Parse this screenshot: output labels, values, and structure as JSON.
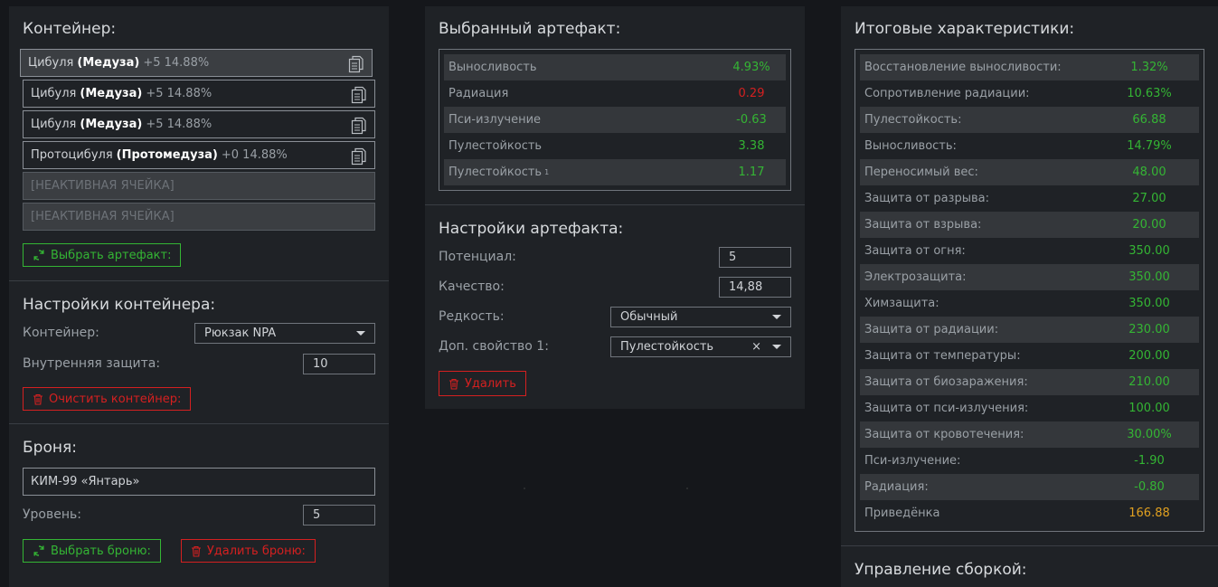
{
  "container": {
    "title": "Контейнер:",
    "slots": [
      {
        "name": "Цибуля",
        "type": "(Медуза)",
        "info": "+5 14.88%"
      },
      {
        "name": "Цибуля",
        "type": "(Медуза)",
        "info": "+5 14.88%"
      },
      {
        "name": "Цибуля",
        "type": "(Медуза)",
        "info": "+5 14.88%"
      },
      {
        "name": "Протоцибуля",
        "type": "(Протомедуза)",
        "info": "+0 14.88%"
      }
    ],
    "inactive_slot": "[НЕАКТИВНАЯ ЯЧЕЙКА]",
    "select_button": "Выбрать артефакт:"
  },
  "container_settings": {
    "title": "Настройки контейнера:",
    "container_label": "Контейнер:",
    "container_value": "Рюкзак NPA",
    "protection_label": "Внутренняя защита:",
    "protection_value": "10",
    "clear_button": "Очистить контейнер:"
  },
  "armor": {
    "title": "Броня:",
    "name": "КИМ-99 «Янтарь»",
    "level_label": "Уровень:",
    "level_value": "5",
    "select_button": "Выбрать броню:",
    "delete_button": "Удалить броню:"
  },
  "selected_artifact": {
    "title": "Выбранный артефакт:",
    "stats": [
      {
        "label": "Выносливость",
        "value": "4.93%",
        "color": "green"
      },
      {
        "label": "Радиация",
        "value": "0.29",
        "color": "red"
      },
      {
        "label": "Пси-излучение",
        "value": "-0.63",
        "color": "green"
      },
      {
        "label": "Пулестойкость",
        "value": "3.38",
        "color": "green"
      },
      {
        "label": "Пулестойкость",
        "sup": "1",
        "value": "1.17",
        "color": "green"
      }
    ]
  },
  "artifact_settings": {
    "title": "Настройки артефакта:",
    "potential_label": "Потенциал:",
    "potential_value": "5",
    "quality_label": "Качество:",
    "quality_value": "14,88",
    "rarity_label": "Редкость:",
    "rarity_value": "Обычный",
    "extra_label": "Доп. свойство 1:",
    "extra_value": "Пулестойкость",
    "delete_button": "Удалить"
  },
  "totals": {
    "title": "Итоговые характеристики:",
    "stats": [
      {
        "label": "Восстановление выносливости:",
        "value": "1.32%",
        "color": "green"
      },
      {
        "label": "Сопротивление радиации:",
        "value": "10.63%",
        "color": "green"
      },
      {
        "label": "Пулестойкость:",
        "value": "66.88",
        "color": "green"
      },
      {
        "label": "Выносливость:",
        "value": "14.79%",
        "color": "green"
      },
      {
        "label": "Переносимый вес:",
        "value": "48.00",
        "color": "green"
      },
      {
        "label": "Защита от разрыва:",
        "value": "27.00",
        "color": "green"
      },
      {
        "label": "Защита от взрыва:",
        "value": "20.00",
        "color": "green"
      },
      {
        "label": "Защита от огня:",
        "value": "350.00",
        "color": "green"
      },
      {
        "label": "Электрозащита:",
        "value": "350.00",
        "color": "green"
      },
      {
        "label": "Химзащита:",
        "value": "350.00",
        "color": "green"
      },
      {
        "label": "Защита от радиации:",
        "value": "230.00",
        "color": "green"
      },
      {
        "label": "Защита от температуры:",
        "value": "200.00",
        "color": "green"
      },
      {
        "label": "Защита от биозаражения:",
        "value": "210.00",
        "color": "green"
      },
      {
        "label": "Защита от пси-излучения:",
        "value": "100.00",
        "color": "green"
      },
      {
        "label": "Защита от кровотечения:",
        "value": "30.00%",
        "color": "green"
      },
      {
        "label": "Пси-излучение:",
        "value": "-1.90",
        "color": "green"
      },
      {
        "label": "Радиация:",
        "value": "-0.80",
        "color": "green"
      },
      {
        "label": "Приведёнка",
        "value": "166.88",
        "color": "gold"
      }
    ]
  },
  "build": {
    "title": "Управление сборкой:"
  }
}
